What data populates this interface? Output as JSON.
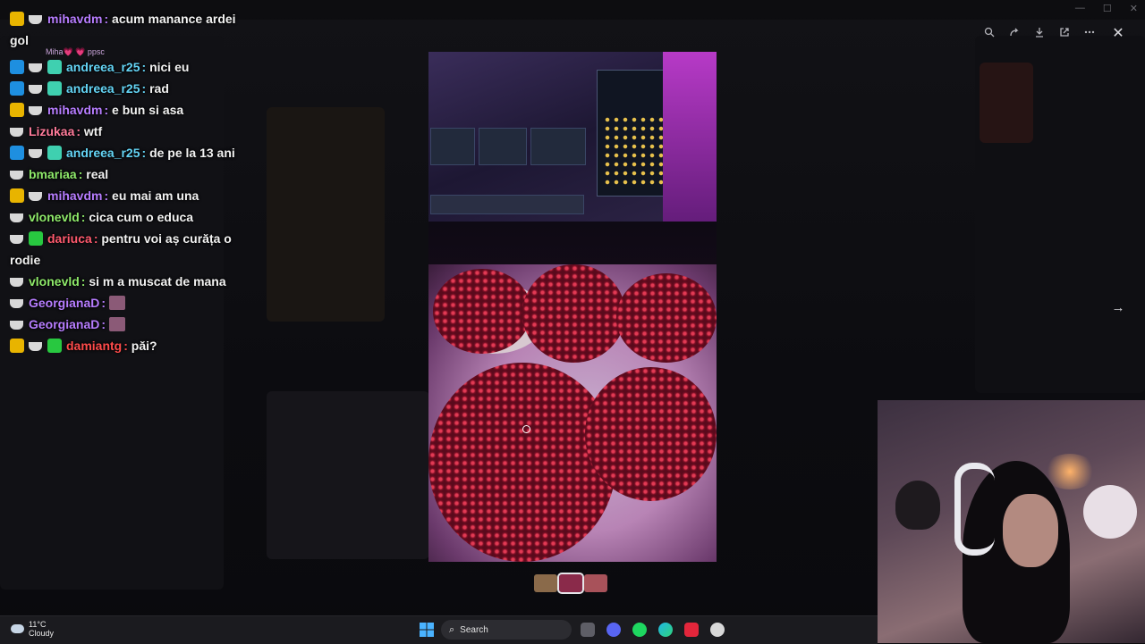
{
  "window": {
    "title": "",
    "controls": [
      "—",
      "☐",
      "✕"
    ]
  },
  "viewer": {
    "toolbar_icons": [
      "zoom-icon",
      "forward-icon",
      "download-icon",
      "open-external-icon",
      "more-icon"
    ],
    "close_glyph": "✕",
    "next_glyph": "→"
  },
  "chat": {
    "messages": [
      {
        "badges": [
          "crown",
          "cup"
        ],
        "user": "mihavdm",
        "color": "#b77dff",
        "text": "acum manance ardei gol",
        "reply_sub": "Miha💗  💗 ppsc"
      },
      {
        "badges": [
          "tool",
          "cup",
          "teal"
        ],
        "user": "andreea_r25",
        "color": "#64d4f5",
        "text": "nici eu"
      },
      {
        "badges": [
          "tool",
          "cup",
          "teal"
        ],
        "user": "andreea_r25",
        "color": "#64d4f5",
        "text": "rad"
      },
      {
        "badges": [
          "crown",
          "cup"
        ],
        "user": "mihavdm",
        "color": "#b77dff",
        "text": "e bun si asa"
      },
      {
        "badges": [
          "cup"
        ],
        "user": "Lizukaa",
        "color": "#ff7b9b",
        "text": "wtf"
      },
      {
        "badges": [
          "tool",
          "cup",
          "teal"
        ],
        "user": "andreea_r25",
        "color": "#64d4f5",
        "text": "de pe la 13 ani"
      },
      {
        "badges": [
          "cup"
        ],
        "user": "bmariaa",
        "color": "#8ee96a",
        "text": "real"
      },
      {
        "badges": [
          "crown",
          "cup"
        ],
        "user": "mihavdm",
        "color": "#b77dff",
        "text": "eu mai am una"
      },
      {
        "badges": [
          "cup"
        ],
        "user": "vlonevld",
        "color": "#8ee96a",
        "text": "cica cum o educa"
      },
      {
        "badges": [
          "cup",
          "green"
        ],
        "user": "dariuca",
        "color": "#ff5a6e",
        "text": "pentru voi aș curăța o rodie"
      },
      {
        "badges": [
          "cup"
        ],
        "user": "vlonevld",
        "color": "#8ee96a",
        "text": "si m a muscat de mana"
      },
      {
        "badges": [
          "cup"
        ],
        "user": "GeorgianaD",
        "color": "#b77dff",
        "text": "",
        "emote": true
      },
      {
        "badges": [
          "cup"
        ],
        "user": "GeorgianaD",
        "color": "#b77dff",
        "text": "",
        "emote": true
      },
      {
        "badges": [
          "crown",
          "cup",
          "green"
        ],
        "user": "damiantg",
        "color": "#ff4b4b",
        "text": "păi?"
      }
    ]
  },
  "taskbar": {
    "weather_temp": "11°C",
    "weather_desc": "Cloudy",
    "search_label": "Search",
    "apps": [
      "file-explorer-icon",
      "discord-icon",
      "spotify-icon",
      "edge-icon",
      "app-red-icon",
      "chrome-icon"
    ]
  }
}
